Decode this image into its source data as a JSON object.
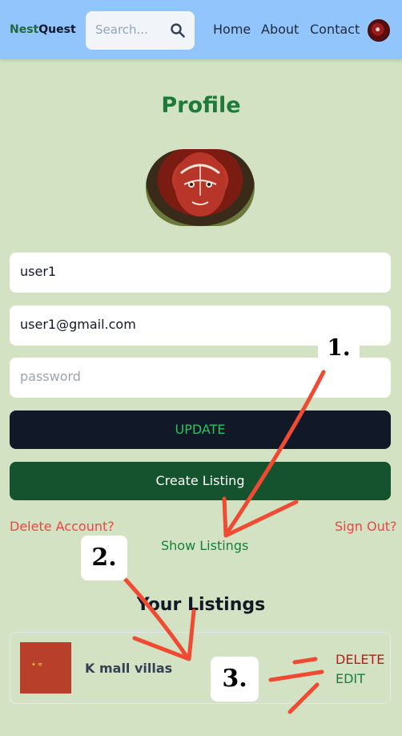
{
  "header": {
    "brand_part1": "Nest",
    "brand_part2": "Quest",
    "search_placeholder": "Search...",
    "nav": [
      "Home",
      "About",
      "Contact"
    ]
  },
  "profile": {
    "title": "Profile",
    "username": "user1",
    "email": "user1@gmail.com",
    "password_placeholder": "password",
    "update_label": "UPDATE",
    "create_listing_label": "Create Listing",
    "delete_account_label": "Delete Account?",
    "sign_out_label": "Sign Out?",
    "show_listings_label": "Show Listings"
  },
  "listings": {
    "title": "Your Listings",
    "items": [
      {
        "name": "K mall villas",
        "delete_label": "DELETE",
        "edit_label": "EDIT"
      }
    ]
  },
  "annotations": [
    "1.",
    "2.",
    "3."
  ],
  "colors": {
    "page_bg": "#d4e2c4",
    "header_bg": "#93c5fd",
    "title_green": "#1d7a3b",
    "update_bg": "#111827",
    "create_bg": "#14532d",
    "danger": "#ef4444",
    "annotation_arrow": "#f04a32"
  }
}
